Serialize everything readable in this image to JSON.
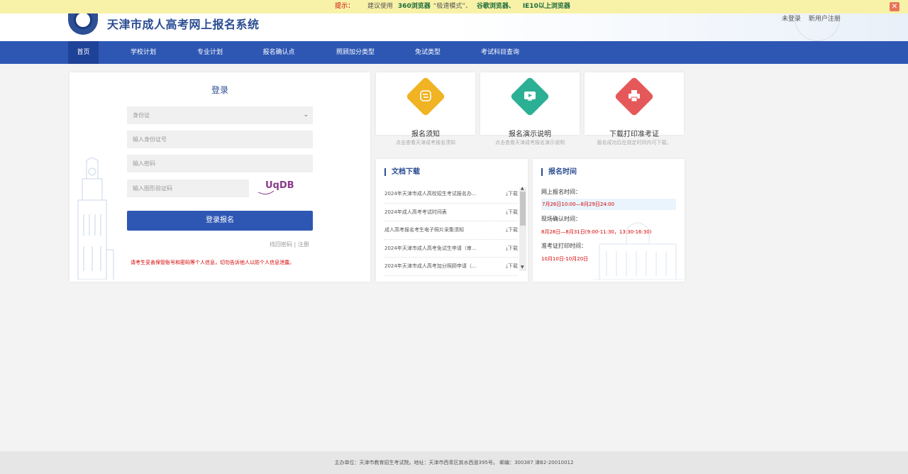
{
  "notice": {
    "label": "提示：",
    "text": "建议使用",
    "browser1": "360浏览器",
    "mode": "“极速模式”、",
    "browser2": "谷歌浏览器、",
    "browser3": "IE10以上浏览器"
  },
  "header": {
    "title": "天津市成人高考网上报名系统",
    "login_link": "未登录",
    "register_link": "新用户注册"
  },
  "nav": {
    "items": [
      "首页",
      "学校计划",
      "专业计划",
      "报名确认点",
      "照顾加分类型",
      "免试类型",
      "考试科目查询"
    ]
  },
  "login": {
    "title": "登录",
    "id_type": "身份证",
    "id_placeholder": "输入身份证号",
    "password_placeholder": "输入密码",
    "captcha_placeholder": "输入图形验证码",
    "captcha_text": "UqDB",
    "submit_label": "登录报名",
    "forgot_label": "找回密码",
    "separator": "|",
    "register_label": "注册",
    "warning": "请考生妥善保管账号和密码等个人信息，切勿告诉他人以防个人信息泄露。"
  },
  "cards": [
    {
      "title": "报名须知",
      "subtitle": "点击查看天津成考报名须知",
      "color": "#f0b323",
      "icon": "flow-icon"
    },
    {
      "title": "报名演示说明",
      "subtitle": "点击查看天津成考报名演示说明",
      "color": "#2cb095",
      "icon": "video-icon"
    },
    {
      "title": "下载打印准考证",
      "subtitle": "报名成功后在规定时间内可下载。",
      "color": "#e5585a",
      "icon": "printer-icon"
    }
  ],
  "docs": {
    "title": "文档下载",
    "download_label": "下载",
    "items": [
      "2024年天津市成人高校招生考试报名办...",
      "2024年成人高考考试时间表",
      "成人高考报名考生电子照片采集须知",
      "2024年天津市成人高考免试生申请（审...",
      "2024年天津市成人高考加分照顾申请（..."
    ]
  },
  "schedule": {
    "title": "报名时间",
    "online_label": "网上报名时间：",
    "online_value": "7月26日10:00—8月29日24:00",
    "onsite_label": "现场确认时间：",
    "onsite_value": "8月28日—8月31日(9:00-11:30，13:30-16:30)",
    "print_label": "准考证打印时间：",
    "print_value": "10月10日-10月20日"
  },
  "footer": {
    "text": "主办单位：天津市教育招生考试院。地址：天津市西青区宾水西道395号。 邮编：300387 津B2-20010012"
  }
}
